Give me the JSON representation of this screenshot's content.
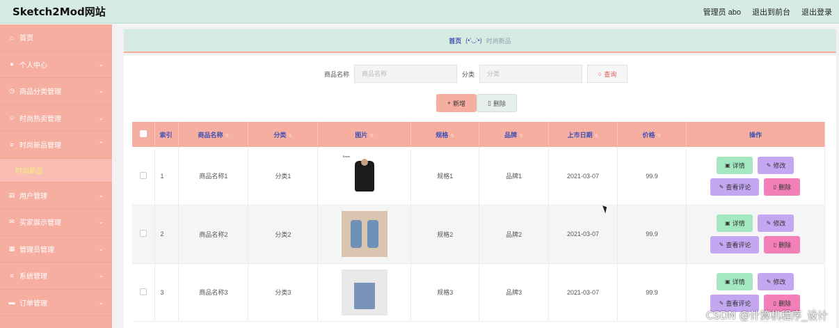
{
  "header": {
    "brand": "Sketch2Mod网站",
    "admin": "管理员 abo",
    "to_front": "退出到前台",
    "logout": "退出登录"
  },
  "sidebar": {
    "items": [
      {
        "label": "首页",
        "icon": "home-icon",
        "glyph": "⌂"
      },
      {
        "label": "个人中心",
        "icon": "user-icon",
        "glyph": "●"
      },
      {
        "label": "商品分类管理",
        "icon": "clock-icon",
        "glyph": "◷"
      },
      {
        "label": "时尚热卖管理",
        "icon": "face-icon",
        "glyph": "☺"
      },
      {
        "label": "时尚新品管理",
        "icon": "menu-icon",
        "glyph": "≡"
      },
      {
        "label": "用户管理",
        "icon": "clipboard-icon",
        "glyph": "▤"
      },
      {
        "label": "买家展示管理",
        "icon": "mail-icon",
        "glyph": "✉"
      },
      {
        "label": "管理员管理",
        "icon": "grid-icon",
        "glyph": "▦"
      },
      {
        "label": "系统管理",
        "icon": "menu-icon",
        "glyph": "≡"
      },
      {
        "label": "订单管理",
        "icon": "ticket-icon",
        "glyph": "▬"
      }
    ],
    "sub_item": "时尚新品"
  },
  "breadcrumb": {
    "home": "首页",
    "face": "(•'◡'•)",
    "current": "时尚新品"
  },
  "search": {
    "name_label": "商品名称",
    "name_placeholder": "商品名称",
    "category_label": "分类",
    "category_placeholder": "分类",
    "query_button": "查询"
  },
  "toolbar": {
    "add": "新增",
    "delete": "删除"
  },
  "table": {
    "headers": [
      "索引",
      "商品名称",
      "分类",
      "图片",
      "规格",
      "品牌",
      "上市日期",
      "价格",
      "操作"
    ],
    "rows": [
      {
        "index": "1",
        "name": "商品名称1",
        "category": "分类1",
        "spec": "规格1",
        "brand": "品牌1",
        "date": "2021-03-07",
        "price": "99.9",
        "image_caption": "Eaton"
      },
      {
        "index": "2",
        "name": "商品名称2",
        "category": "分类2",
        "spec": "规格2",
        "brand": "品牌2",
        "date": "2021-03-07",
        "price": "99.9"
      },
      {
        "index": "3",
        "name": "商品名称3",
        "category": "分类3",
        "spec": "规格3",
        "brand": "品牌3",
        "date": "2021-03-07",
        "price": "99.9"
      }
    ],
    "row_actions": {
      "detail": "详情",
      "edit": "修改",
      "comment": "查看评论",
      "remove": "删除"
    }
  },
  "watermark": "CSDN @计算机程序_设计",
  "colors": {
    "header_bg": "#d6ece2",
    "sidebar_bg": "#f6aea1",
    "table_header_bg": "#f6aea1",
    "header_text": "#3f51b5",
    "detail_btn": "#a3e8c1",
    "edit_btn": "#c4a7f0",
    "remove_btn": "#f27fb8"
  }
}
